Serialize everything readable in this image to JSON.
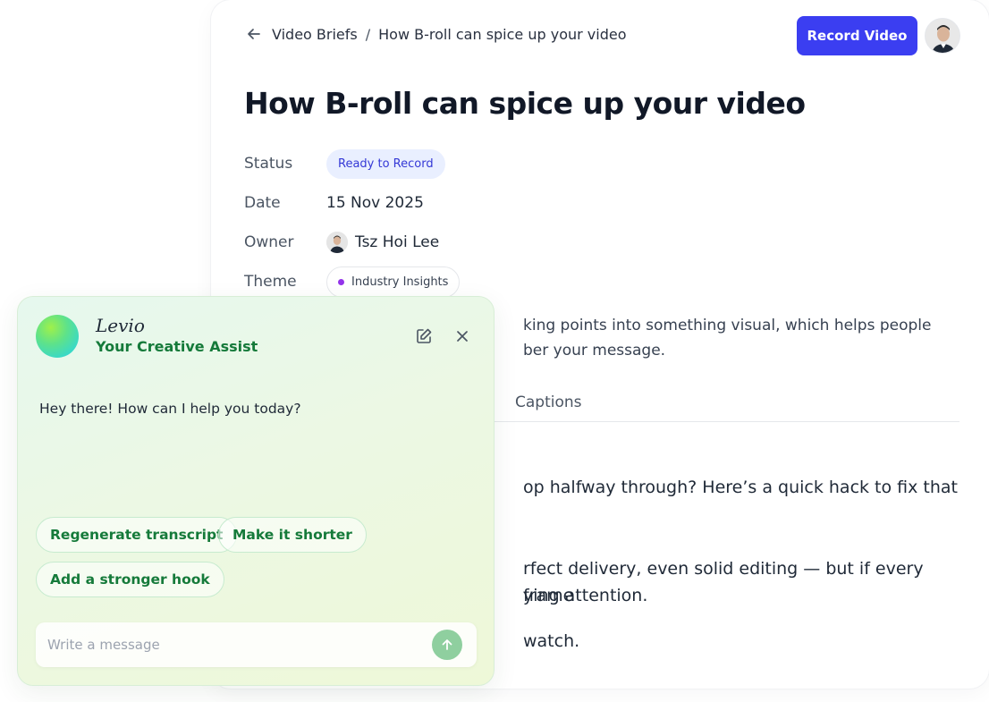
{
  "header": {
    "breadcrumb": {
      "parent": "Video Briefs",
      "separator": "/",
      "current": "How B-roll can spice up your video"
    },
    "record_label": "Record Video"
  },
  "doc": {
    "title": "How B-roll can spice up your video",
    "status_label": "Status",
    "status_value": "Ready to Record",
    "date_label": "Date",
    "date_value": "15 Nov 2025",
    "owner_label": "Owner",
    "owner_value": "Tsz Hoi Lee",
    "theme_label": "Theme",
    "theme_value": "Industry Insights",
    "desc_line1": "king points into something visual, which helps people",
    "desc_line2": "ber your message.",
    "tabs": [
      "Captions"
    ],
    "body": [
      "op halfway through? Here’s a quick hack to fix that",
      "rfect delivery, even solid editing — but if every frame",
      "ying attention.",
      "watch."
    ]
  },
  "assistant": {
    "name": "Levio",
    "subtitle": "Your Creative Assist",
    "greeting": "Hey there! How can I help you today?",
    "chips": [
      "Regenerate transcript",
      "Make it shorter",
      "Add a stronger hook"
    ],
    "input_placeholder": "Write a message"
  },
  "icons": [
    "back-arrow-icon",
    "edit-icon",
    "close-icon",
    "send-arrow-icon"
  ],
  "colors": {
    "accent": "#3b3ef1",
    "assistant_green": "#157a3a",
    "status_bg": "#e9efff",
    "theme_dot": "#9333ea"
  }
}
